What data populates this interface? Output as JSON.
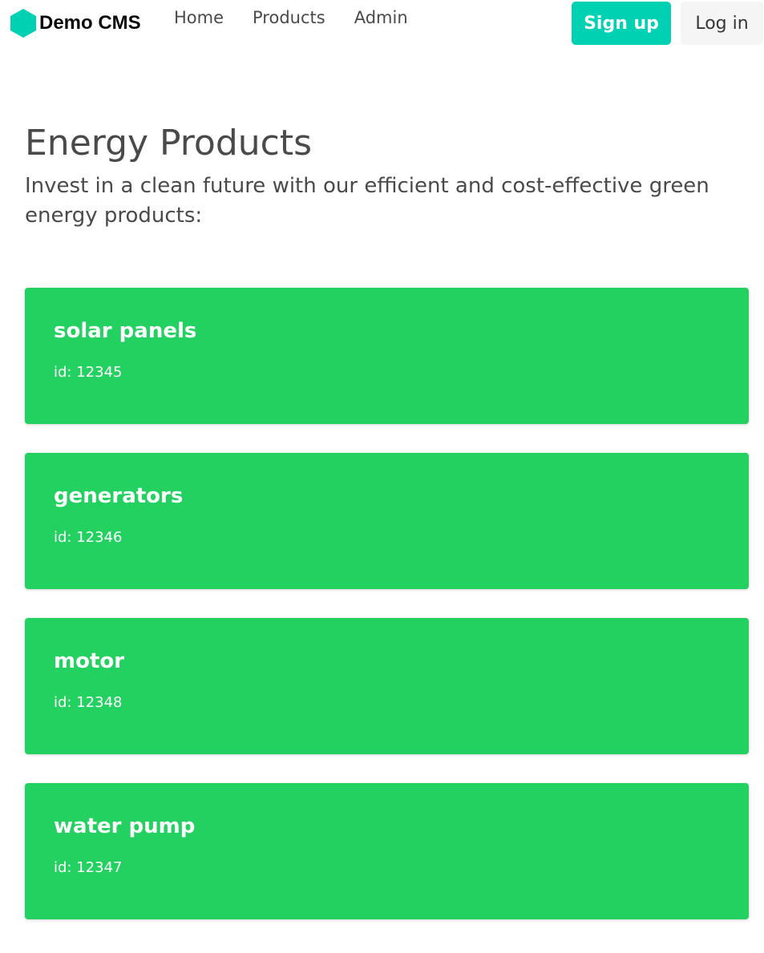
{
  "brand": {
    "name": "Demo CMS",
    "icon": "hexagon-logo-icon",
    "color": "#00d1b2"
  },
  "nav": {
    "links": [
      "Home",
      "Products",
      "Admin"
    ]
  },
  "actions": {
    "signup_label": "Sign up",
    "login_label": "Log in",
    "signup_color": "#00d1b2"
  },
  "hero": {
    "title": "Energy Products",
    "subtitle": "Invest in a clean future with our efficient and cost-effective green energy products:"
  },
  "products": [
    {
      "name": "solar panels",
      "id": "id: 12345"
    },
    {
      "name": "generators",
      "id": "id: 12346"
    },
    {
      "name": "motor",
      "id": "id: 12348"
    },
    {
      "name": "water pump",
      "id": "id: 12347"
    }
  ],
  "colors": {
    "card": "#23d160",
    "text": "#4a4a4a"
  }
}
